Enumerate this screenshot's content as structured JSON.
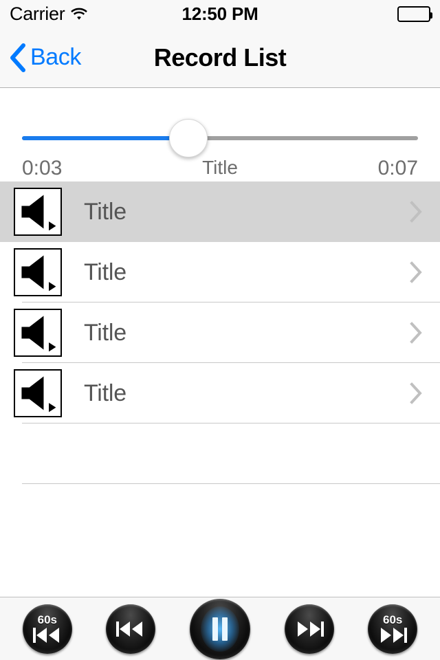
{
  "status_bar": {
    "carrier": "Carrier",
    "wifi_icon": "wifi-icon",
    "time": "12:50 PM",
    "battery_icon": "battery-full-icon"
  },
  "nav_bar": {
    "back_icon": "chevron-left-icon",
    "back_label": "Back",
    "title": "Record List"
  },
  "player": {
    "slider": {
      "progress_percent": 42,
      "fill_color": "#1a7ced",
      "track_color": "#a0a0a0",
      "knob_color": "#ffffff"
    },
    "elapsed_time": "0:03",
    "track_title": "Title",
    "total_time": "0:07"
  },
  "list": {
    "rows": [
      {
        "icon": "speaker-play-icon",
        "label": "Title",
        "accessory": "chevron-right-icon",
        "selected": true
      },
      {
        "icon": "speaker-play-icon",
        "label": "Title",
        "accessory": "chevron-right-icon",
        "selected": false
      },
      {
        "icon": "speaker-play-icon",
        "label": "Title",
        "accessory": "chevron-right-icon",
        "selected": false
      },
      {
        "icon": "speaker-play-icon",
        "label": "Title",
        "accessory": "chevron-right-icon",
        "selected": false
      }
    ],
    "empty_rows": 2,
    "separator_color": "#c8c8c8",
    "selected_row_color": "#d4d4d4"
  },
  "toolbar": {
    "buttons": [
      {
        "name": "skip-back-60s-button",
        "badge": "60s",
        "icon": "rewind-bar-icon"
      },
      {
        "name": "rewind-button",
        "badge": "",
        "icon": "rewind-icon"
      },
      {
        "name": "pause-button",
        "badge": "",
        "icon": "pause-icon"
      },
      {
        "name": "fast-forward-button",
        "badge": "",
        "icon": "fast-forward-icon"
      },
      {
        "name": "skip-forward-60s-button",
        "badge": "60s",
        "icon": "forward-bar-icon"
      }
    ],
    "accent_color": "#5abeff"
  }
}
